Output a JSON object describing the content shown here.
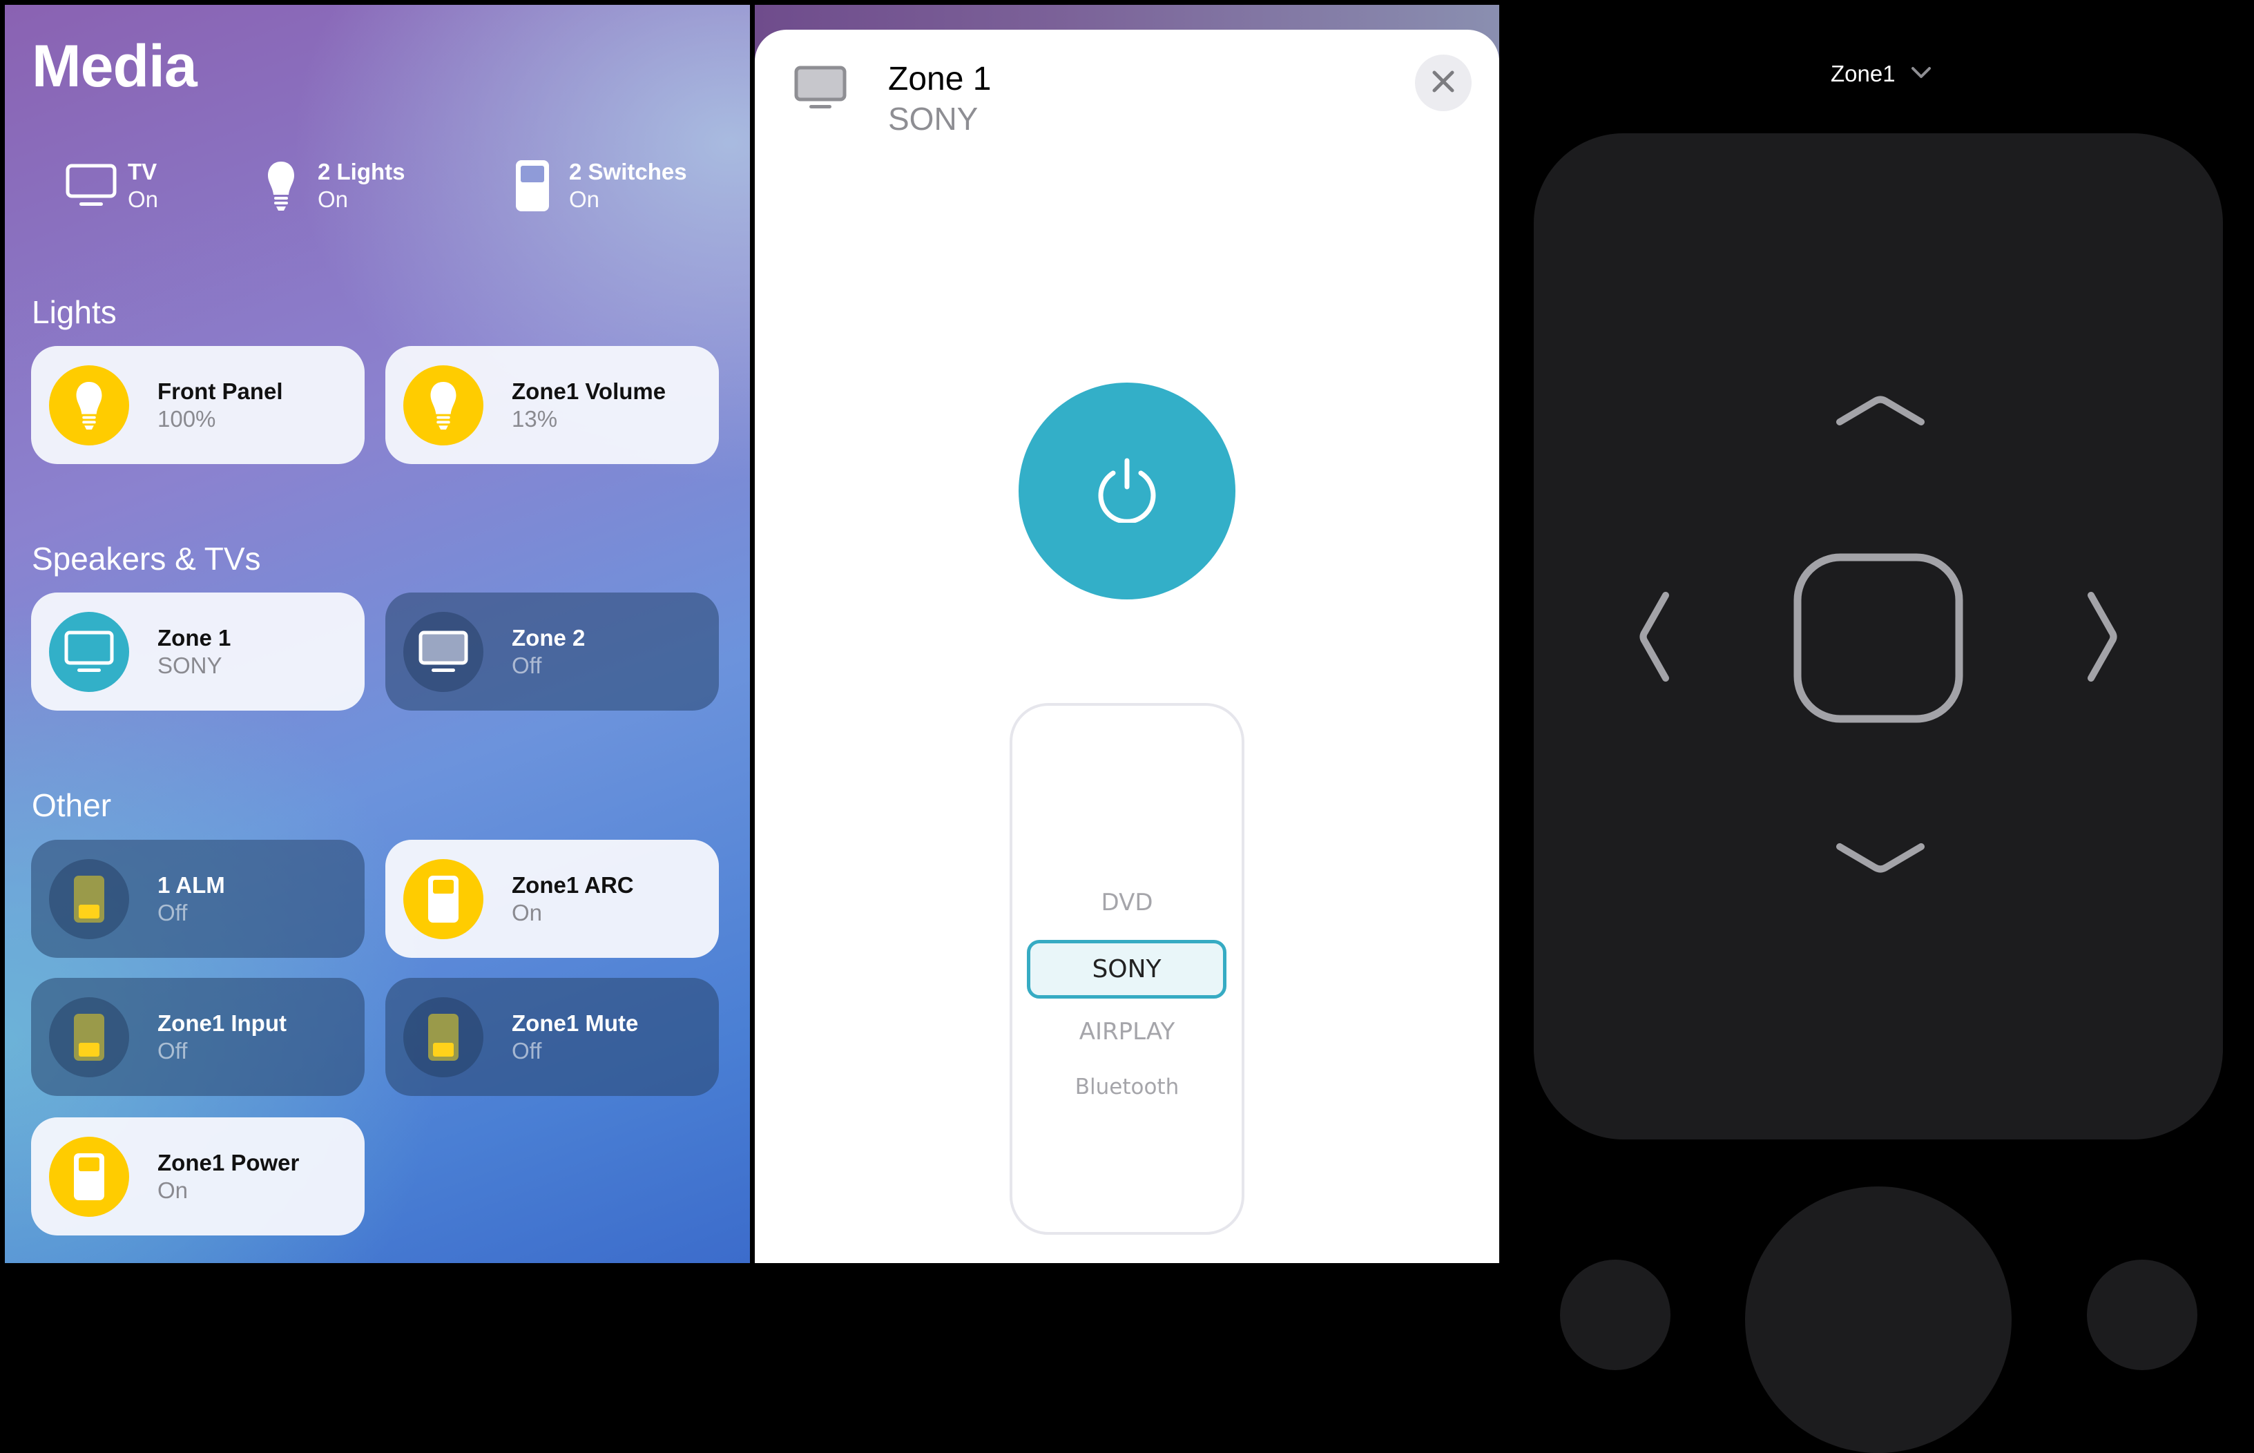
{
  "left_panel": {
    "title": "Media",
    "summary": [
      {
        "icon": "tv-icon",
        "label": "TV",
        "status": "On"
      },
      {
        "icon": "lightbulb-icon",
        "label": "2 Lights",
        "status": "On"
      },
      {
        "icon": "switch-icon",
        "label": "2 Switches",
        "status": "On"
      }
    ],
    "sections": [
      {
        "title": "Lights",
        "tiles": [
          {
            "name": "Front Panel",
            "status": "100%",
            "icon": "lightbulb-icon",
            "state": "on",
            "brightness_percent": 100
          },
          {
            "name": "Zone1 Volume",
            "status": "13%",
            "icon": "lightbulb-icon",
            "state": "on",
            "brightness_percent": 13
          }
        ]
      },
      {
        "title": "Speakers & TVs",
        "tiles": [
          {
            "name": "Zone 1",
            "status": "SONY",
            "icon": "tv-icon",
            "state": "on"
          },
          {
            "name": "Zone 2",
            "status": "Off",
            "icon": "tv-icon",
            "state": "off"
          }
        ]
      },
      {
        "title": "Other",
        "tiles": [
          {
            "name": "1 ALM",
            "status": "Off",
            "icon": "switch-icon",
            "state": "off"
          },
          {
            "name": "Zone1 ARC",
            "status": "On",
            "icon": "switch-icon",
            "state": "on"
          },
          {
            "name": "Zone1 Input",
            "status": "Off",
            "icon": "switch-icon",
            "state": "off"
          },
          {
            "name": "Zone1 Mute",
            "status": "Off",
            "icon": "switch-icon",
            "state": "off"
          },
          {
            "name": "Zone1 Power",
            "status": "On",
            "icon": "switch-icon",
            "state": "on"
          }
        ]
      }
    ]
  },
  "detail_sheet": {
    "title": "Zone 1",
    "subtitle": "SONY",
    "icon": "tv-icon",
    "close_icon": "close-icon",
    "power_icon": "power-icon",
    "input_picker": {
      "options": [
        "DVD",
        "SONY",
        "AIRPLAY",
        "Bluetooth"
      ],
      "selected": "SONY"
    }
  },
  "remote": {
    "zone_label": "Zone1",
    "dropdown_icon": "chevron-down-icon",
    "dpad": [
      "chevron-up-icon",
      "chevron-down-icon",
      "chevron-left-icon",
      "chevron-right-icon",
      "select-button"
    ]
  },
  "colors": {
    "accent_teal": "#33afc8",
    "light_on_yellow": "#ffcc00",
    "remote_surface": "#1c1c1e",
    "remote_glyph": "#a3a3a8"
  }
}
